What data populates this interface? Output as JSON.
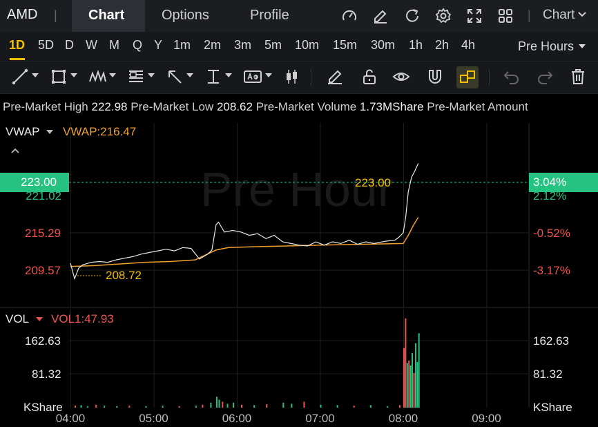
{
  "header": {
    "ticker": "AMD",
    "separator": "|",
    "tabs": [
      {
        "label": "Chart",
        "active": true
      },
      {
        "label": "Options",
        "active": false
      },
      {
        "label": "Profile",
        "active": false
      }
    ],
    "chart_menu": "Chart"
  },
  "timeframes": {
    "items": [
      "1D",
      "5D",
      "D",
      "W",
      "M",
      "Q",
      "Y",
      "1m",
      "2m",
      "3m",
      "5m",
      "10m",
      "15m",
      "30m",
      "1h",
      "2h",
      "4h"
    ],
    "active": "1D",
    "session": "Pre Hours"
  },
  "info": {
    "high_label": "Pre-Market High",
    "high_value": "222.98",
    "low_label": "Pre-Market Low",
    "low_value": "208.62",
    "volume_label": "Pre-Market Volume",
    "volume_value": "1.73MShare",
    "amount_label": "Pre-Market Amount"
  },
  "price_panel": {
    "indicator": "VWAP",
    "indicator_value": "VWAP:216.47",
    "watermark": "Pre Hour",
    "current_price": "223.00",
    "current_pct": "3.04%",
    "axis_left": [
      "221.02",
      "215.29",
      "209.57"
    ],
    "axis_right": [
      "2.12%",
      "-0.52%",
      "-3.17%"
    ],
    "high_marker": "223.00",
    "low_marker": "208.72"
  },
  "volume_panel": {
    "indicator": "VOL",
    "indicator_value": "VOL1:47.93",
    "axis_left": [
      "162.63",
      "81.32",
      "KShare"
    ],
    "axis_right": [
      "162.63",
      "81.32",
      "KShare"
    ]
  },
  "time_axis": [
    "04:00",
    "05:00",
    "06:00",
    "07:00",
    "08:00",
    "09:00"
  ],
  "colors": {
    "up": "#26c281",
    "down": "#ef5350",
    "accent": "#f2c200",
    "vwap": "#f0a030"
  },
  "chart_data": {
    "type": "line",
    "x_range": [
      "04:00",
      "09:00"
    ],
    "price_series": {
      "points": [
        [
          0,
          210.8
        ],
        [
          0.05,
          208.9
        ],
        [
          0.1,
          210.2
        ],
        [
          0.15,
          210.6
        ],
        [
          0.25,
          210.9
        ],
        [
          0.35,
          211.0
        ],
        [
          0.45,
          210.9
        ],
        [
          0.55,
          211.2
        ],
        [
          0.65,
          211.4
        ],
        [
          0.75,
          211.6
        ],
        [
          0.85,
          211.9
        ],
        [
          0.95,
          212.1
        ],
        [
          1.05,
          212.3
        ],
        [
          1.15,
          212.5
        ],
        [
          1.25,
          212.3
        ],
        [
          1.35,
          212.7
        ],
        [
          1.45,
          212.6
        ],
        [
          1.55,
          211.3
        ],
        [
          1.6,
          211.6
        ],
        [
          1.65,
          211.9
        ],
        [
          1.7,
          212.4
        ],
        [
          1.75,
          215.5
        ],
        [
          1.78,
          215.8
        ],
        [
          1.85,
          214.6
        ],
        [
          1.95,
          214.8
        ],
        [
          2.05,
          214.6
        ],
        [
          2.15,
          214.2
        ],
        [
          2.25,
          214.4
        ],
        [
          2.35,
          213.8
        ],
        [
          2.45,
          214.2
        ],
        [
          2.55,
          213.4
        ],
        [
          2.65,
          213.2
        ],
        [
          2.75,
          213.0
        ],
        [
          2.85,
          212.9
        ],
        [
          2.95,
          213.4
        ],
        [
          3.05,
          213.0
        ],
        [
          3.15,
          213.4
        ],
        [
          3.25,
          213.2
        ],
        [
          3.35,
          213.6
        ],
        [
          3.45,
          213.1
        ],
        [
          3.55,
          213.4
        ],
        [
          3.65,
          213.2
        ],
        [
          3.75,
          213.4
        ],
        [
          3.8,
          213.5
        ],
        [
          3.9,
          213.6
        ],
        [
          3.95,
          214.0
        ],
        [
          4.0,
          214.5
        ],
        [
          4.03,
          216.5
        ],
        [
          4.06,
          219.5
        ],
        [
          4.1,
          221.3
        ],
        [
          4.14,
          222.1
        ],
        [
          4.18,
          223.0
        ]
      ]
    },
    "vwap_series": {
      "points": [
        [
          0,
          210.4
        ],
        [
          0.3,
          210.5
        ],
        [
          0.6,
          210.7
        ],
        [
          0.9,
          210.9
        ],
        [
          1.2,
          211.0
        ],
        [
          1.5,
          211.2
        ],
        [
          1.75,
          212.4
        ],
        [
          1.9,
          212.7
        ],
        [
          2.2,
          212.8
        ],
        [
          2.6,
          212.9
        ],
        [
          3.0,
          213.0
        ],
        [
          3.5,
          213.1
        ],
        [
          4.0,
          213.2
        ],
        [
          4.06,
          214.2
        ],
        [
          4.12,
          215.4
        ],
        [
          4.18,
          216.4
        ]
      ]
    },
    "volume_series": {
      "bars": [
        [
          0.05,
          4,
          "down"
        ],
        [
          0.12,
          5,
          "up"
        ],
        [
          0.2,
          3,
          "up"
        ],
        [
          0.3,
          6,
          "down"
        ],
        [
          0.4,
          4,
          "up"
        ],
        [
          0.55,
          3,
          "up"
        ],
        [
          0.7,
          4,
          "down"
        ],
        [
          0.9,
          3,
          "up"
        ],
        [
          1.1,
          4,
          "up"
        ],
        [
          1.3,
          3,
          "down"
        ],
        [
          1.5,
          4,
          "up"
        ],
        [
          1.58,
          6,
          "down"
        ],
        [
          1.68,
          10,
          "up"
        ],
        [
          1.75,
          22,
          "up"
        ],
        [
          1.78,
          16,
          "up"
        ],
        [
          1.82,
          12,
          "down"
        ],
        [
          1.88,
          8,
          "up"
        ],
        [
          1.95,
          10,
          "up"
        ],
        [
          2.05,
          6,
          "down"
        ],
        [
          2.2,
          5,
          "up"
        ],
        [
          2.35,
          7,
          "down"
        ],
        [
          2.55,
          10,
          "up"
        ],
        [
          2.65,
          8,
          "up"
        ],
        [
          2.8,
          12,
          "down"
        ],
        [
          3.0,
          6,
          "up"
        ],
        [
          3.2,
          5,
          "up"
        ],
        [
          3.4,
          4,
          "down"
        ],
        [
          3.6,
          5,
          "up"
        ],
        [
          3.8,
          3,
          "up"
        ],
        [
          3.95,
          5,
          "down"
        ],
        [
          4.0,
          120,
          "red"
        ],
        [
          4.02,
          180,
          "down"
        ],
        [
          4.04,
          90,
          "up"
        ],
        [
          4.06,
          95,
          "down"
        ],
        [
          4.08,
          85,
          "up"
        ],
        [
          4.1,
          110,
          "up"
        ],
        [
          4.12,
          70,
          "down"
        ],
        [
          4.14,
          130,
          "up"
        ],
        [
          4.16,
          92,
          "up"
        ],
        [
          4.18,
          150,
          "up"
        ]
      ]
    },
    "price_range": [
      205.8,
      226.5
    ],
    "volume_range": [
      0,
      195
    ]
  }
}
